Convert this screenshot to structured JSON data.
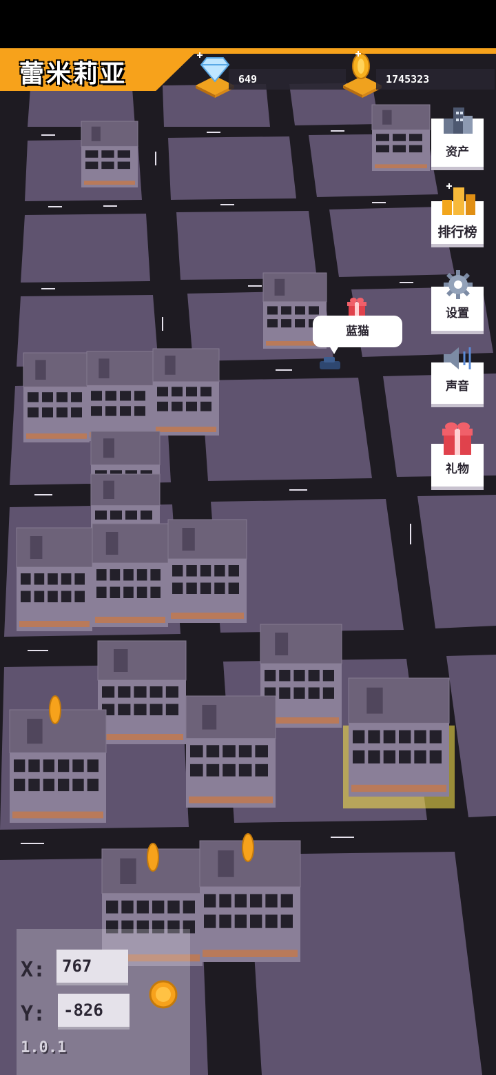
{
  "player": {
    "name": "蕾米莉亚"
  },
  "resources": {
    "diamonds": {
      "icon": "diamond-icon",
      "value": "649"
    },
    "coins": {
      "icon": "coin-icon",
      "value": "1745323"
    }
  },
  "side_menu": [
    {
      "key": "assets",
      "icon": "buildings-icon",
      "label": "资产"
    },
    {
      "key": "leaderboard",
      "icon": "leaderboard-icon",
      "label": "排行榜"
    },
    {
      "key": "settings",
      "icon": "gear-icon",
      "label": "设置"
    },
    {
      "key": "sound",
      "icon": "speaker-icon",
      "label": "声音"
    },
    {
      "key": "gift",
      "icon": "gift-icon",
      "label": "礼物"
    }
  ],
  "other_player": {
    "name": "蓝猫",
    "icon": "gift-icon"
  },
  "coordinates": {
    "x_label": "X:",
    "x_value": "767",
    "y_label": "Y:",
    "y_value": "-826"
  },
  "version": "1.0.1",
  "colors": {
    "accent": "#f7a21b",
    "ground": "#5f536f",
    "road": "#1e1b22",
    "highlight": "#ffe94a"
  }
}
